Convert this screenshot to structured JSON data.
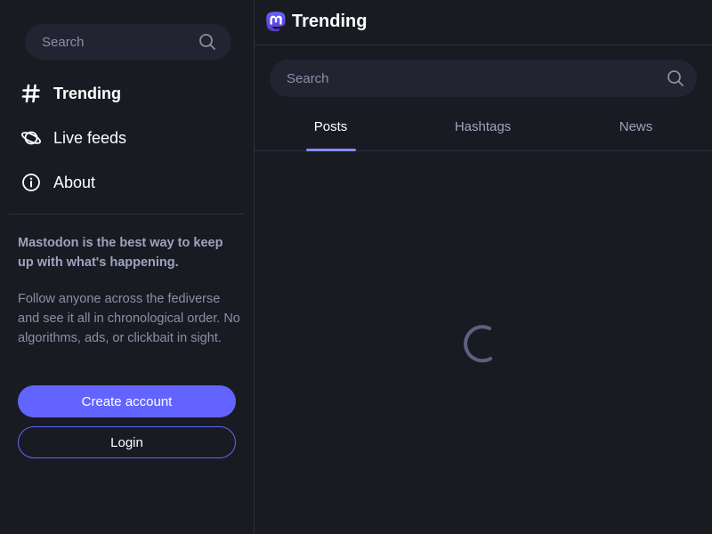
{
  "sidebar": {
    "search": {
      "placeholder": "Search",
      "icon": "search-icon"
    },
    "nav": [
      {
        "label": "Trending",
        "icon": "hashtag-icon",
        "active": true
      },
      {
        "label": "Live feeds",
        "icon": "planet-icon",
        "active": false
      },
      {
        "label": "About",
        "icon": "info-icon",
        "active": false
      }
    ],
    "pitch": {
      "title": "Mastodon is the best way to keep up with what's happening.",
      "body": "Follow anyone across the fediverse and see it all in chronological order. No algorithms, ads, or clickbait in sight."
    },
    "create_account_label": "Create account",
    "login_label": "Login"
  },
  "main": {
    "header": {
      "title": "Trending",
      "logo": "mastodon-logo-icon"
    },
    "search": {
      "placeholder": "Search",
      "icon": "search-icon"
    },
    "tabs": [
      {
        "label": "Posts",
        "active": true
      },
      {
        "label": "Hashtags",
        "active": false
      },
      {
        "label": "News",
        "active": false
      }
    ],
    "loading_indicator": "loading-spinner-icon"
  },
  "colors": {
    "background": "#191b22",
    "panel": "#222431",
    "accent": "#6364ff",
    "tab_indicator": "#858afa",
    "divider": "#2e3040",
    "muted_text": "#8a8fa8"
  }
}
